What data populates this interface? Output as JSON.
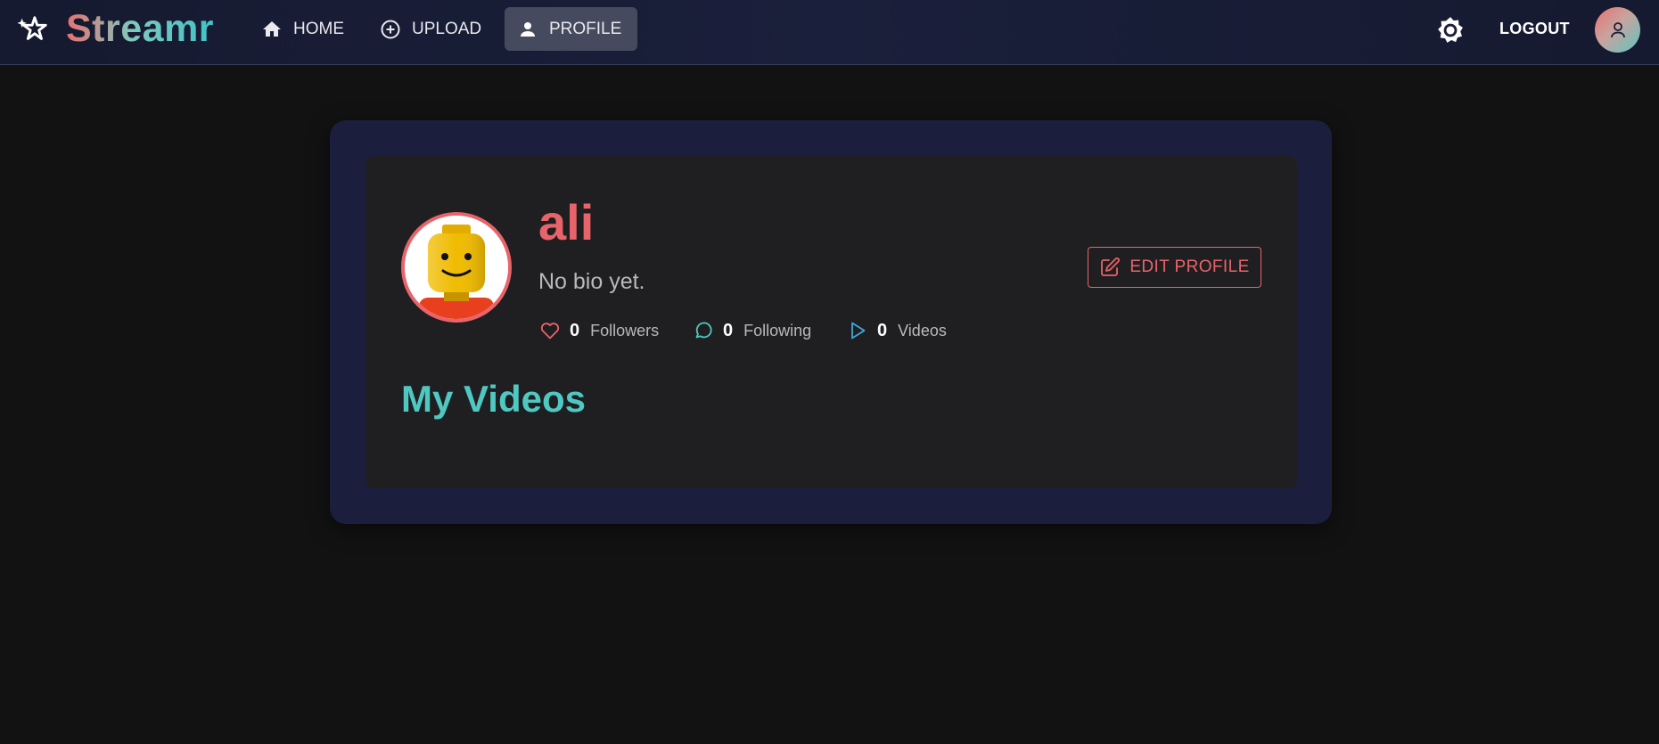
{
  "app": {
    "name": "Streamr",
    "logo_icon": "sparkle-star-icon"
  },
  "nav": {
    "items": [
      {
        "label": "HOME",
        "icon": "home-icon"
      },
      {
        "label": "UPLOAD",
        "icon": "add-circle-icon"
      },
      {
        "label": "PROFILE",
        "icon": "person-icon",
        "active": true
      }
    ],
    "theme_toggle_icon": "brightness-icon",
    "logout_label": "LOGOUT",
    "account_icon": "user-avatar-icon"
  },
  "profile": {
    "username": "ali",
    "bio": "No bio yet.",
    "avatar_icon": "lego-head-avatar",
    "stats": [
      {
        "count": "0",
        "label": "Followers",
        "icon": "heart-icon"
      },
      {
        "count": "0",
        "label": "Following",
        "icon": "chat-bubble-icon"
      },
      {
        "count": "0",
        "label": "Videos",
        "icon": "play-icon"
      }
    ],
    "edit_button_label": "EDIT PROFILE",
    "edit_button_icon": "edit-icon"
  },
  "section": {
    "title": "My Videos"
  },
  "colors": {
    "accent_coral": "#e8646a",
    "accent_teal": "#4fc8c2",
    "navbar_bg": "#1a1f3b",
    "page_bg": "#121212",
    "card_bg": "#1f1f21"
  }
}
